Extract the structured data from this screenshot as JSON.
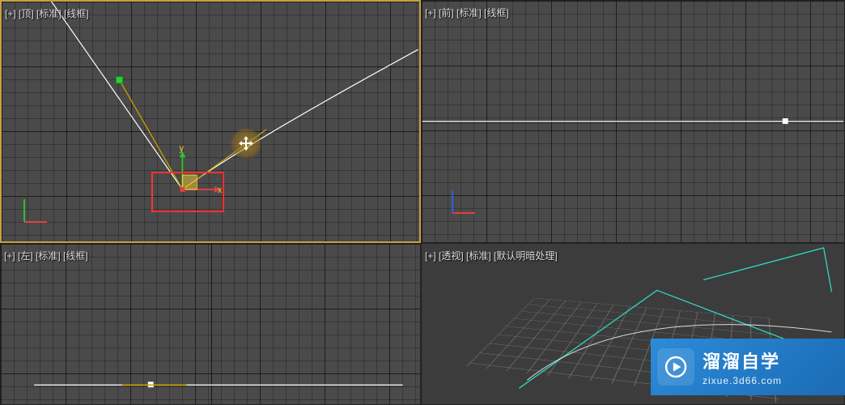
{
  "viewports": {
    "top": {
      "label": "[+] [顶] [标准] [线框]"
    },
    "front": {
      "label": "[+] [前] [标准] [线框]"
    },
    "left": {
      "label": "[+] [左] [标准] [线框]"
    },
    "persp": {
      "label": "[+] [透视] [标准] [默认明暗处理]"
    }
  },
  "gizmo": {
    "x_axis": "x",
    "y_axis": "y"
  },
  "watermark": {
    "title": "溜溜自学",
    "subtitle": "zixue.3d66.com"
  },
  "colors": {
    "active_border": "#c8a040",
    "selection": "#ff3030",
    "spline": "#ffffff",
    "tangent": "#c8a000",
    "axis_x": "#e04040",
    "axis_y": "#30c030",
    "axis_z": "#3060e0",
    "persp_line": "#2fd8c2"
  }
}
